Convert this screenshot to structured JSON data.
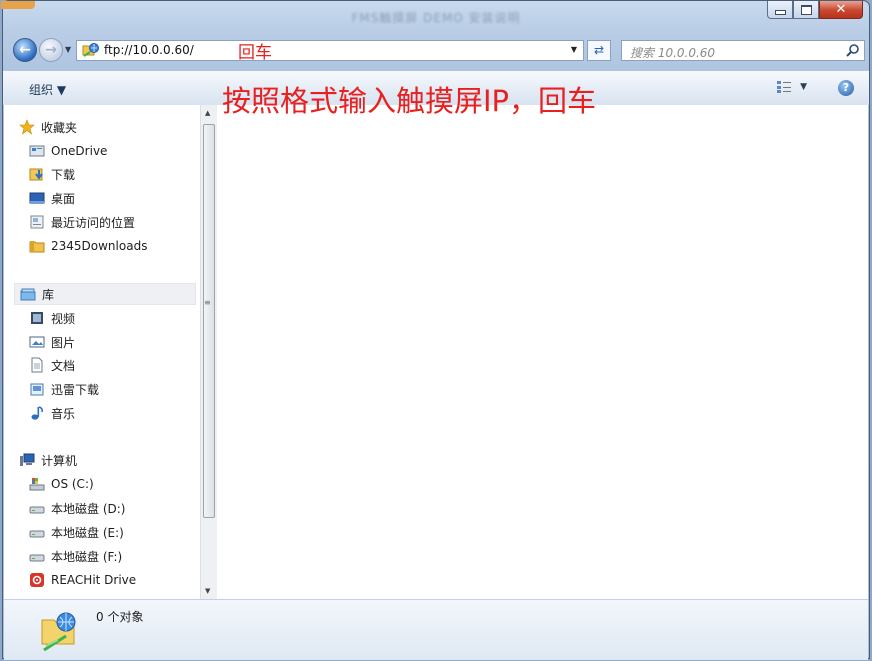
{
  "window": {
    "title": "FMS触摸屏 DEMO 安装说明",
    "controls": {
      "minimize": "minimize",
      "maximize": "maximize",
      "close": "✕"
    }
  },
  "address": {
    "value": "ftp://10.0.0.60/",
    "search_placeholder": "搜索 10.0.0.60"
  },
  "annotations": {
    "small": "回车",
    "big": "按照格式输入触摸屏IP，回车",
    "color": "#e8201f"
  },
  "toolbar": {
    "organize_label": "组织 ▼",
    "view_icon": "view-options-icon",
    "help_icon": "help-icon"
  },
  "nav": {
    "favorites": {
      "label": "收藏夹",
      "items": [
        {
          "label": "OneDrive",
          "icon": "onedrive-icon"
        },
        {
          "label": "下载",
          "icon": "downloads-icon"
        },
        {
          "label": "桌面",
          "icon": "desktop-icon"
        },
        {
          "label": "最近访问的位置",
          "icon": "recent-places-icon"
        },
        {
          "label": "2345Downloads",
          "icon": "folder-icon"
        }
      ]
    },
    "libraries": {
      "label": "库",
      "items": [
        {
          "label": "视频",
          "icon": "videos-icon"
        },
        {
          "label": "图片",
          "icon": "pictures-icon"
        },
        {
          "label": "文档",
          "icon": "documents-icon"
        },
        {
          "label": "迅雷下载",
          "icon": "thunder-downloads-icon"
        },
        {
          "label": "音乐",
          "icon": "music-icon"
        }
      ]
    },
    "computer": {
      "label": "计算机",
      "items": [
        {
          "label": "OS (C:)",
          "icon": "system-drive-icon"
        },
        {
          "label": "本地磁盘 (D:)",
          "icon": "drive-icon"
        },
        {
          "label": "本地磁盘 (E:)",
          "icon": "drive-icon"
        },
        {
          "label": "本地磁盘 (F:)",
          "icon": "drive-icon"
        },
        {
          "label": "REACHit Drive",
          "icon": "reachit-drive-icon"
        }
      ]
    }
  },
  "status": {
    "object_count": "0 个对象"
  }
}
